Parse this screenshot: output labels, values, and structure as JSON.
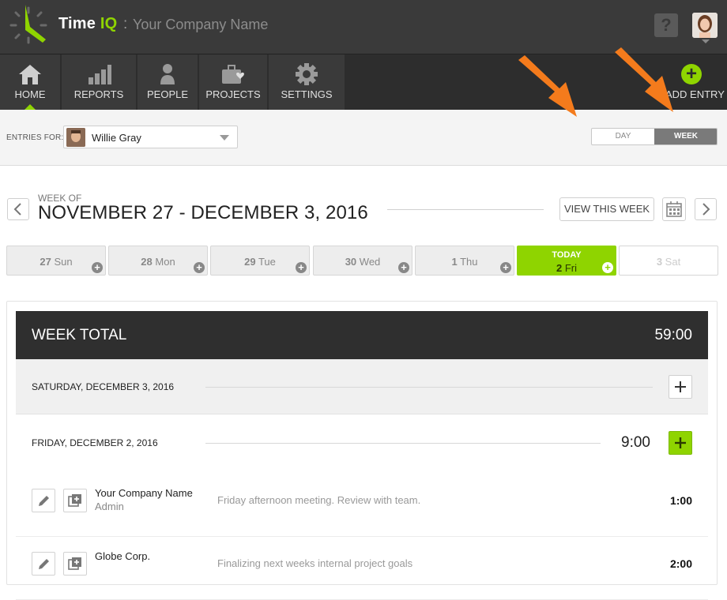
{
  "app": {
    "brand_main": "Time ",
    "brand_accent": "IQ",
    "separator": ":",
    "company": "Your Company Name",
    "help_label": "?"
  },
  "nav": {
    "items": [
      {
        "label": "HOME",
        "icon": "home-icon"
      },
      {
        "label": "REPORTS",
        "icon": "bar-chart-icon"
      },
      {
        "label": "PEOPLE",
        "icon": "person-icon"
      },
      {
        "label": "PROJECTS",
        "icon": "briefcase-heart-icon"
      },
      {
        "label": "SETTINGS",
        "icon": "gear-icon"
      }
    ],
    "add_entry_label": "ADD ENTRY",
    "add_entry_symbol": "+"
  },
  "filter": {
    "entries_for_label": "ENTRIES FOR:",
    "selected_user": "Willie Gray",
    "view_toggle": {
      "day": "DAY",
      "week": "WEEK",
      "active": "WEEK"
    }
  },
  "week": {
    "week_of_label": "WEEK OF",
    "range": "NOVEMBER 27 - DECEMBER 3, 2016",
    "view_this_week": "VIEW THIS WEEK"
  },
  "days": [
    {
      "num": "27",
      "name": "Sun",
      "state": "past"
    },
    {
      "num": "28",
      "name": "Mon",
      "state": "past"
    },
    {
      "num": "29",
      "name": "Tue",
      "state": "past"
    },
    {
      "num": "30",
      "name": "Wed",
      "state": "past"
    },
    {
      "num": "1",
      "name": "Thu",
      "state": "past"
    },
    {
      "num": "2",
      "name": "Fri",
      "state": "today",
      "today_label": "TODAY"
    },
    {
      "num": "3",
      "name": "Sat",
      "state": "future"
    }
  ],
  "summary": {
    "week_total_label": "WEEK TOTAL",
    "week_total_value": "59:00"
  },
  "day_groups": [
    {
      "title": "SATURDAY, DECEMBER 3, 2016",
      "total": ""
    },
    {
      "title": "FRIDAY, DECEMBER 2, 2016",
      "total": "9:00"
    }
  ],
  "entries": [
    {
      "client": "Your Company Name",
      "role": "Admin",
      "note": "Friday afternoon meeting. Review with team.",
      "duration": "1:00"
    },
    {
      "client": "Globe Corp.",
      "role": "",
      "note": "Finalizing next weeks internal project goals",
      "duration": "2:00"
    }
  ],
  "colors": {
    "accent": "#8fd400",
    "topbar": "#3a3a3a",
    "navbar": "#2d2d2d",
    "arrow": "#f47b1c"
  }
}
